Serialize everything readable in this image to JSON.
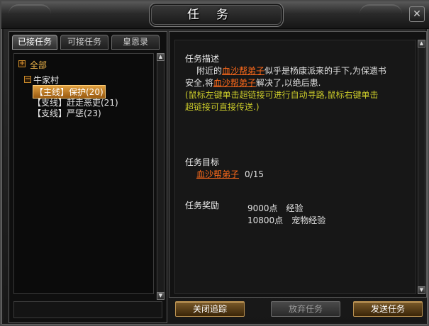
{
  "window": {
    "title": "任务",
    "close_glyph": "✕"
  },
  "tabs": [
    {
      "label": "已接任务",
      "active": true
    },
    {
      "label": "可接任务",
      "active": false
    },
    {
      "label": "皇恩录",
      "active": false
    }
  ],
  "tree": {
    "root": {
      "expander": "+",
      "label": "全部"
    },
    "group": {
      "expander": "−",
      "label": "牛家村"
    },
    "quests": [
      {
        "label": "【主线】保护(20)",
        "selected": true
      },
      {
        "label": "【支线】赶走恶吏(21)",
        "selected": false
      },
      {
        "label": "【支线】严惩(23)",
        "selected": false
      }
    ]
  },
  "detail": {
    "description_heading": "任务描述",
    "description": {
      "line1_pre": "附近的",
      "line1_link": "血沙帮弟子",
      "line1_post": "似乎是杨康派来的手下,为保遗书",
      "line2_pre": "安全,将",
      "line2_link": "血沙帮弟子",
      "line2_post": "解决了,以绝后患."
    },
    "hint_lines": [
      "(鼠标左键单击超链接可进行自动寻路,鼠标右键单击",
      "超链接可直接传送.)"
    ],
    "target_heading": "任务目标",
    "target": {
      "link": "血沙帮弟子",
      "progress": "0/15"
    },
    "reward_heading": "任务奖励",
    "rewards": [
      {
        "amount": "9000点",
        "type": "经验"
      },
      {
        "amount": "10800点",
        "type": "宠物经验"
      }
    ]
  },
  "buttons": {
    "close_tracking": "关闭追踪",
    "abandon": "放弃任务",
    "send": "发送任务"
  },
  "colors": {
    "link": "#ff6a1a",
    "hint": "#c9c92a",
    "gold": "#f2b84b",
    "button_gold": "#b89050"
  }
}
